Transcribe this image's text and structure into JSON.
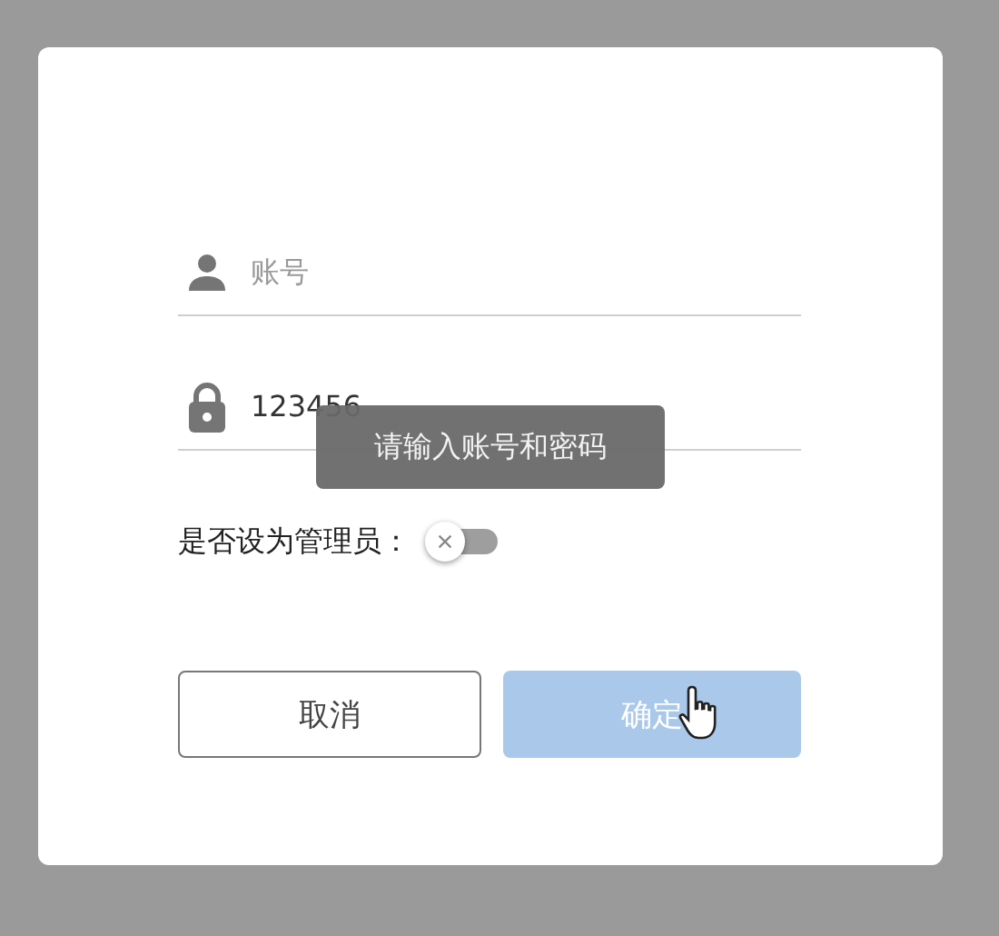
{
  "dialog": {
    "fields": [
      {
        "kind": "account",
        "placeholder": "账号"
      },
      {
        "kind": "password",
        "value": "123456"
      }
    ],
    "admin_switch": {
      "label": "是否设为管理员：",
      "on": false
    },
    "buttons": [
      {
        "label": "取消",
        "kind": "secondary",
        "disabled": false
      },
      {
        "label": "确定",
        "kind": "primary",
        "disabled": true
      }
    ]
  },
  "toast": {
    "message": "请输入账号和密码"
  }
}
